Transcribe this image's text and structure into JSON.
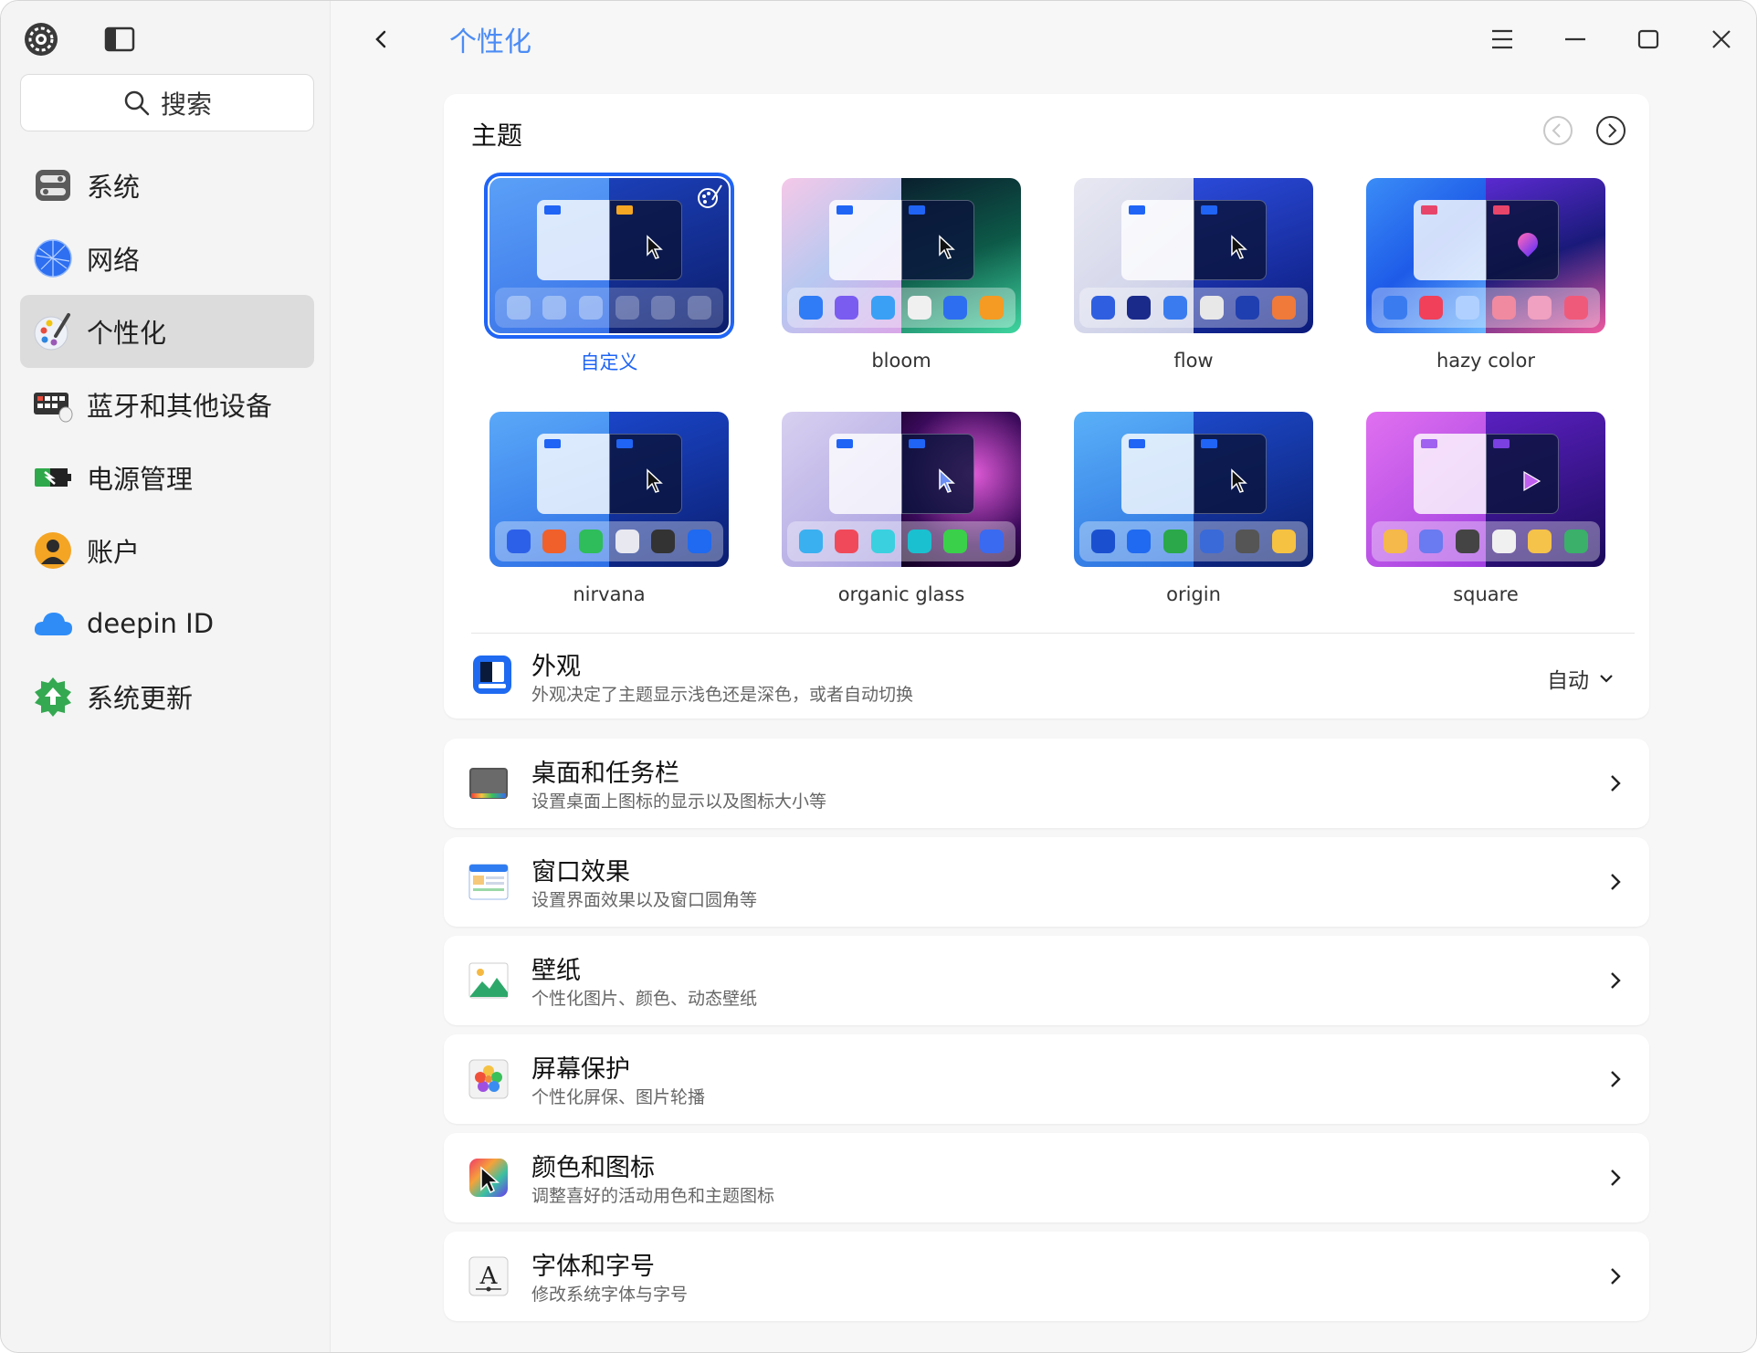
{
  "window": {
    "page_title": "个性化",
    "search_label": "搜索"
  },
  "sidebar": {
    "items": [
      {
        "label": "系统",
        "icon": "toggle-switches-icon"
      },
      {
        "label": "网络",
        "icon": "globe-network-icon"
      },
      {
        "label": "个性化",
        "icon": "palette-brush-icon",
        "active": true
      },
      {
        "label": "蓝牙和其他设备",
        "icon": "keyboard-devices-icon"
      },
      {
        "label": "电源管理",
        "icon": "battery-power-icon"
      },
      {
        "label": "账户",
        "icon": "account-person-icon"
      },
      {
        "label": "deepin ID",
        "icon": "cloud-icon"
      },
      {
        "label": "系统更新",
        "icon": "update-arrow-icon"
      }
    ]
  },
  "theme_section": {
    "title": "主题",
    "themes": [
      {
        "label": "自定义",
        "selected": true
      },
      {
        "label": "bloom"
      },
      {
        "label": "flow"
      },
      {
        "label": "hazy color"
      },
      {
        "label": "nirvana"
      },
      {
        "label": "organic glass"
      },
      {
        "label": "origin"
      },
      {
        "label": "square"
      }
    ],
    "appearance": {
      "title": "外观",
      "subtitle": "外观决定了主题显示浅色还是深色，或者自动切换",
      "value": "自动"
    }
  },
  "settings_rows": [
    {
      "title": "桌面和任务栏",
      "subtitle": "设置桌面上图标的显示以及图标大小等",
      "icon": "desktop-taskbar-icon"
    },
    {
      "title": "窗口效果",
      "subtitle": "设置界面效果以及窗口圆角等",
      "icon": "window-effect-icon"
    },
    {
      "title": "壁纸",
      "subtitle": "个性化图片、颜色、动态壁纸",
      "icon": "wallpaper-icon"
    },
    {
      "title": "屏幕保护",
      "subtitle": "个性化屏保、图片轮播",
      "icon": "screensaver-icon"
    },
    {
      "title": "颜色和图标",
      "subtitle": "调整喜好的活动用色和主题图标",
      "icon": "color-icons-icon"
    },
    {
      "title": "字体和字号",
      "subtitle": "修改系统字体与字号",
      "icon": "font-size-icon"
    }
  ],
  "colors": {
    "accent": "#1f64f5",
    "title_blue": "#4c8cf5",
    "sidebar_bg": "#f4f4f4",
    "active_item_bg": "#dcdcdc"
  }
}
